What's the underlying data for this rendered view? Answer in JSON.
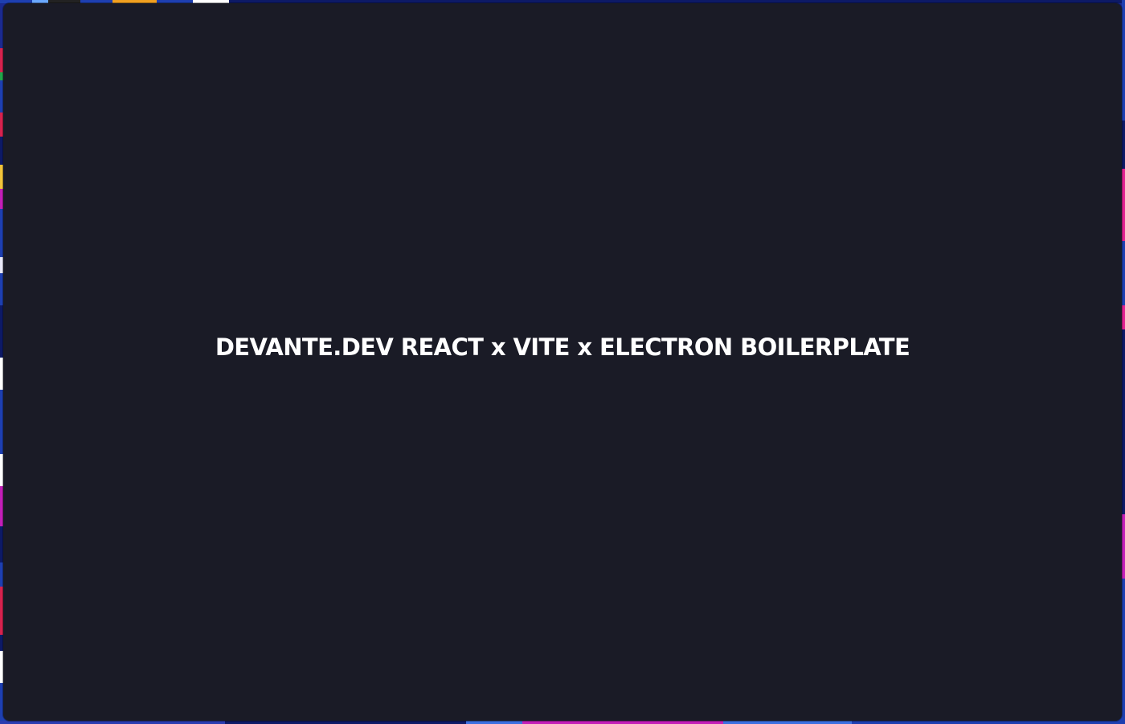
{
  "app": {
    "title": "DEVANTE.DEV REACT x VITE x ELECTRON BOILERPLATE"
  },
  "colors": {
    "window_background": "#1a1b26",
    "title_text": "#ffffff"
  }
}
